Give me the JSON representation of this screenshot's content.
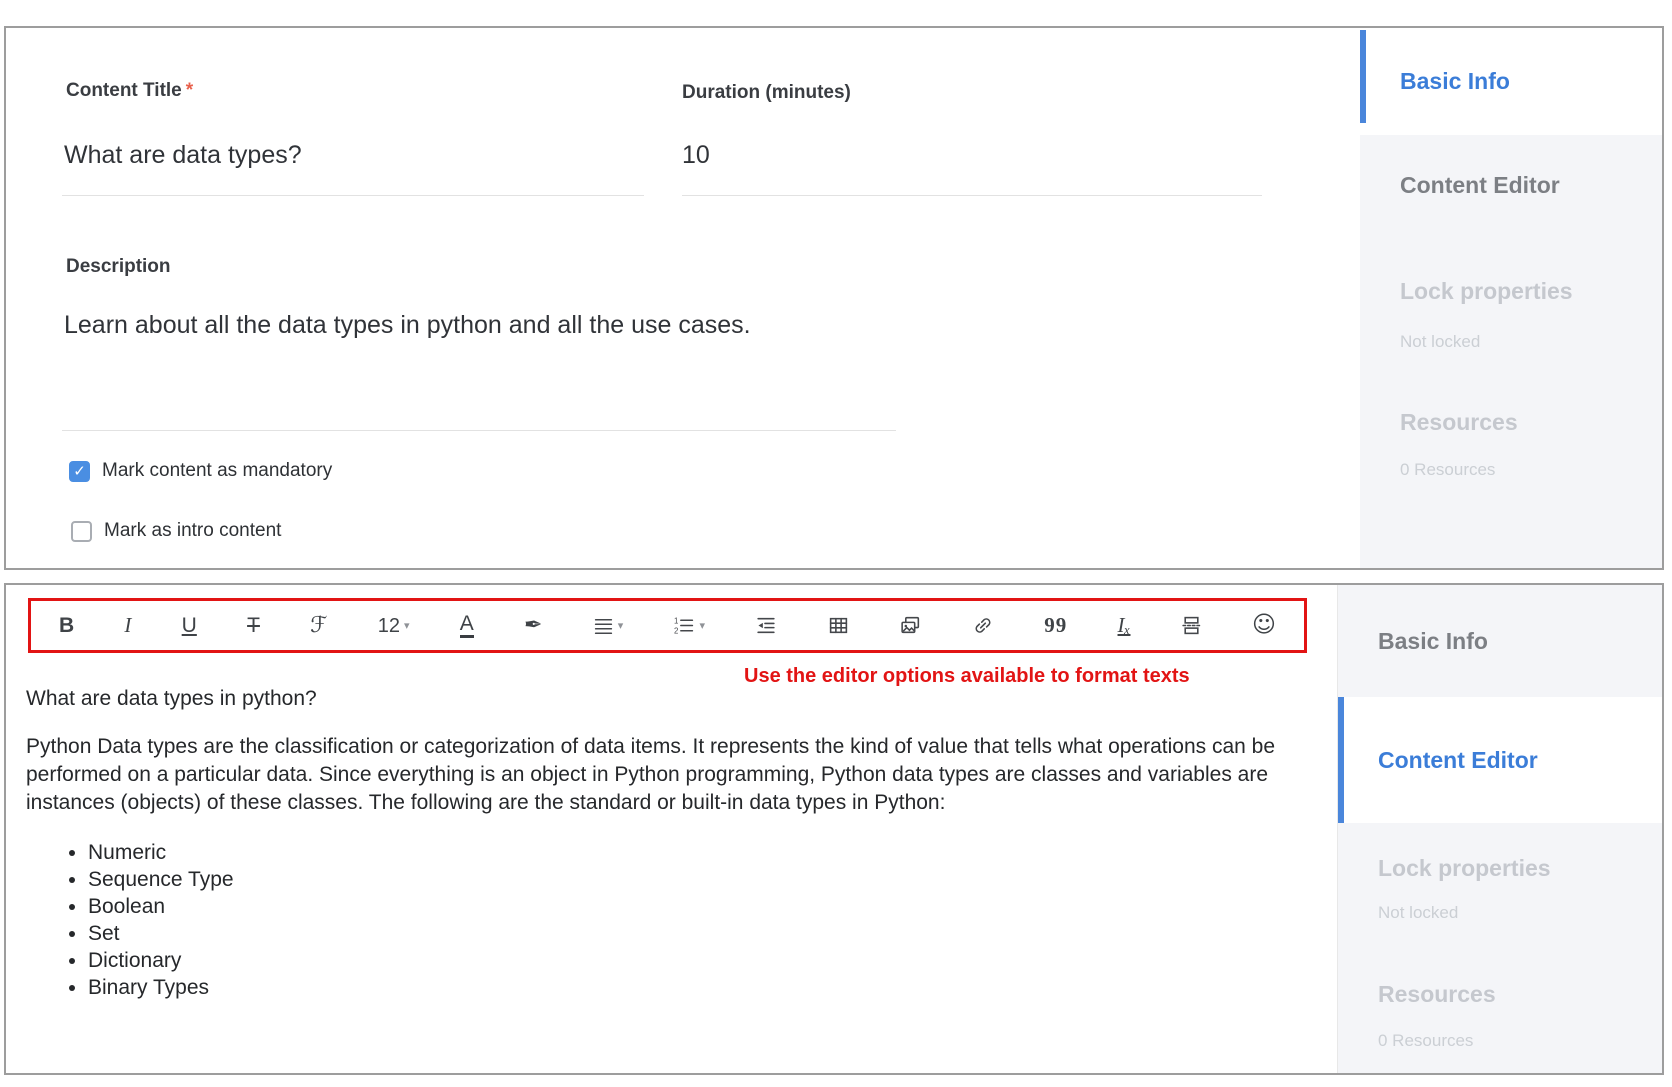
{
  "colors": {
    "accent_blue": "#3b7dd8",
    "bar_blue": "#4a86db",
    "checkbox_blue": "#4a8ee2",
    "annotation_red": "#e21414",
    "panel_border": "#9d9d9d",
    "sidebar_gray_bg": "#f4f5f8"
  },
  "basic_info_panel": {
    "fields": {
      "content_title": {
        "label": "Content Title",
        "required_marker": "*",
        "value": "What are data types?"
      },
      "duration": {
        "label": "Duration (minutes)",
        "value": "10"
      },
      "description": {
        "label": "Description",
        "value": "Learn about all the data types in python and all the use cases."
      }
    },
    "checkboxes": [
      {
        "label": "Mark content as mandatory",
        "checked": true
      },
      {
        "label": "Mark as intro content",
        "checked": false
      }
    ],
    "sidebar": {
      "items": [
        {
          "label": "Basic Info",
          "state": "active"
        },
        {
          "label": "Content Editor",
          "state": "inactive"
        },
        {
          "label": "Lock properties",
          "sub": "Not locked",
          "state": "disabled"
        },
        {
          "label": "Resources",
          "sub": "0 Resources",
          "state": "disabled"
        }
      ]
    }
  },
  "editor_panel": {
    "toolbar": {
      "font_size_value": "12",
      "items": [
        {
          "name": "bold",
          "type": "text",
          "glyph": "B"
        },
        {
          "name": "italic",
          "type": "text",
          "glyph": "I"
        },
        {
          "name": "underline",
          "type": "text",
          "glyph": "U"
        },
        {
          "name": "strikethrough",
          "type": "text",
          "glyph": "T"
        },
        {
          "name": "font-family",
          "type": "text",
          "glyph": "ℱ"
        },
        {
          "name": "font-size",
          "type": "text",
          "glyph": "12",
          "dropdown": true
        },
        {
          "name": "font-color",
          "type": "text",
          "glyph": "A"
        },
        {
          "name": "highlight",
          "type": "text",
          "glyph": "✒"
        },
        {
          "name": "align",
          "type": "svg",
          "dropdown": true
        },
        {
          "name": "ordered-list",
          "type": "svg",
          "dropdown": true
        },
        {
          "name": "indent",
          "type": "svg"
        },
        {
          "name": "table",
          "type": "svg"
        },
        {
          "name": "image",
          "type": "svg"
        },
        {
          "name": "link",
          "type": "svg"
        },
        {
          "name": "quote",
          "type": "text",
          "glyph": "99"
        },
        {
          "name": "clear-formatting",
          "type": "text",
          "glyph": "Iₓ"
        },
        {
          "name": "page-break",
          "type": "svg"
        },
        {
          "name": "emoji",
          "type": "text",
          "glyph": "☺"
        }
      ]
    },
    "annotation": "Use the editor options available to format texts",
    "content": {
      "heading": "What are data types in python?",
      "paragraph": "Python Data types are the classification or categorization of data items. It represents the kind of value that tells what operations can be performed on a particular data. Since everything is an object in Python programming, Python data types are classes and variables are instances (objects) of these classes. The following are the standard or built-in data types in Python:",
      "bullets": [
        "Numeric",
        "Sequence Type",
        "Boolean",
        "Set",
        "Dictionary",
        "Binary Types"
      ]
    },
    "sidebar": {
      "items": [
        {
          "label": "Basic Info",
          "state": "inactive"
        },
        {
          "label": "Content Editor",
          "state": "active"
        },
        {
          "label": "Lock properties",
          "sub": "Not locked",
          "state": "disabled"
        },
        {
          "label": "Resources",
          "sub": "0 Resources",
          "state": "disabled"
        }
      ]
    }
  }
}
